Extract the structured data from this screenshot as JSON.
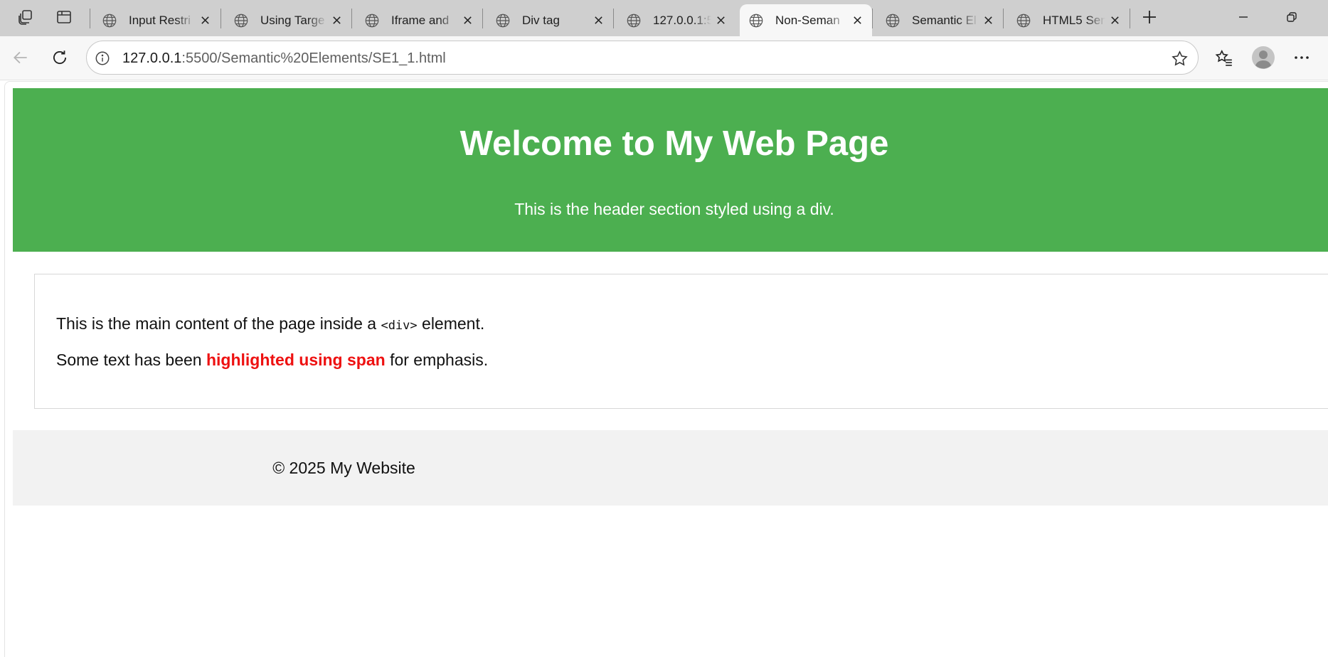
{
  "browser": {
    "tabs": [
      {
        "title": "Input Restri",
        "active": false
      },
      {
        "title": "Using Targe",
        "active": false
      },
      {
        "title": "Iframe and",
        "active": false
      },
      {
        "title": "Div tag",
        "active": false
      },
      {
        "title": "127.0.0.1:55",
        "active": false
      },
      {
        "title": "Non-Seman",
        "active": true
      },
      {
        "title": "Semantic El",
        "active": false
      },
      {
        "title": "HTML5 Sen",
        "active": false
      }
    ],
    "address": {
      "host": "127.0.0.1",
      "rest": ":5500/Semantic%20Elements/SE1_1.html"
    },
    "icons": {
      "workspaces": "workspaces-icon",
      "tab_actions": "tab-actions-icon",
      "favicon": "globe-icon",
      "new_tab": "plus-icon",
      "back": "back-arrow-icon",
      "refresh": "refresh-icon",
      "info": "info-icon",
      "favorite": "star-icon",
      "favorites": "favorites-icon",
      "profile": "profile-avatar-icon",
      "more": "more-icon"
    }
  },
  "page": {
    "header": {
      "title": "Welcome to My Web Page",
      "subtitle": "This is the header section styled using a div."
    },
    "main": {
      "line1_before": "This is the main content of the page inside a ",
      "line1_code": "<div>",
      "line1_after": " element.",
      "line2_before": "Some text has been ",
      "line2_highlight": "highlighted using span",
      "line2_after": " for emphasis."
    },
    "footer": {
      "text": "© 2025 My Website"
    }
  },
  "colors": {
    "header_bg": "#4caf50",
    "highlight": "#ee1111",
    "footer_bg": "#f2f2f2",
    "tabbar_bg": "#cfcfcf"
  }
}
